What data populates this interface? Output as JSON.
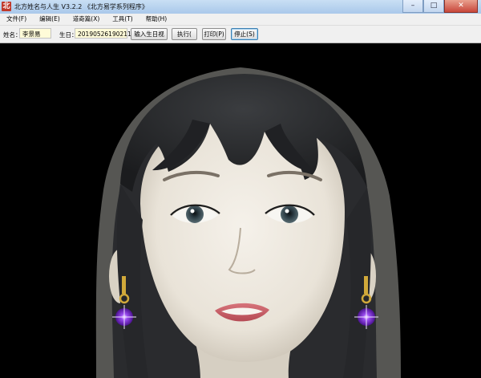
{
  "window": {
    "title": "北方姓名与人生 V3.2.2  《北方易学系列程序》",
    "app_icon_glyph": "北",
    "minimize_glyph": "–",
    "maximize_glyph": "□",
    "close_glyph": "✕"
  },
  "menu": [
    "文件(F)",
    "编辑(E)",
    "道奇篇(X)",
    "工具(T)",
    "帮助(H)"
  ],
  "toolbar": {
    "name_label": "姓名：",
    "name_value": "李景易",
    "birth_label": "生日：",
    "birth_value": "201905261902110",
    "enter_birth_button": "输入生日视",
    "run_button": "执行(",
    "print_button": "打印(P)",
    "stop_button": "停止(S)"
  },
  "colors": {
    "titlebar": "#b9d3ef",
    "field_background": "#fffbd8",
    "earring_gem": "#7b2fd0",
    "earring_gold": "#d1a93a"
  }
}
